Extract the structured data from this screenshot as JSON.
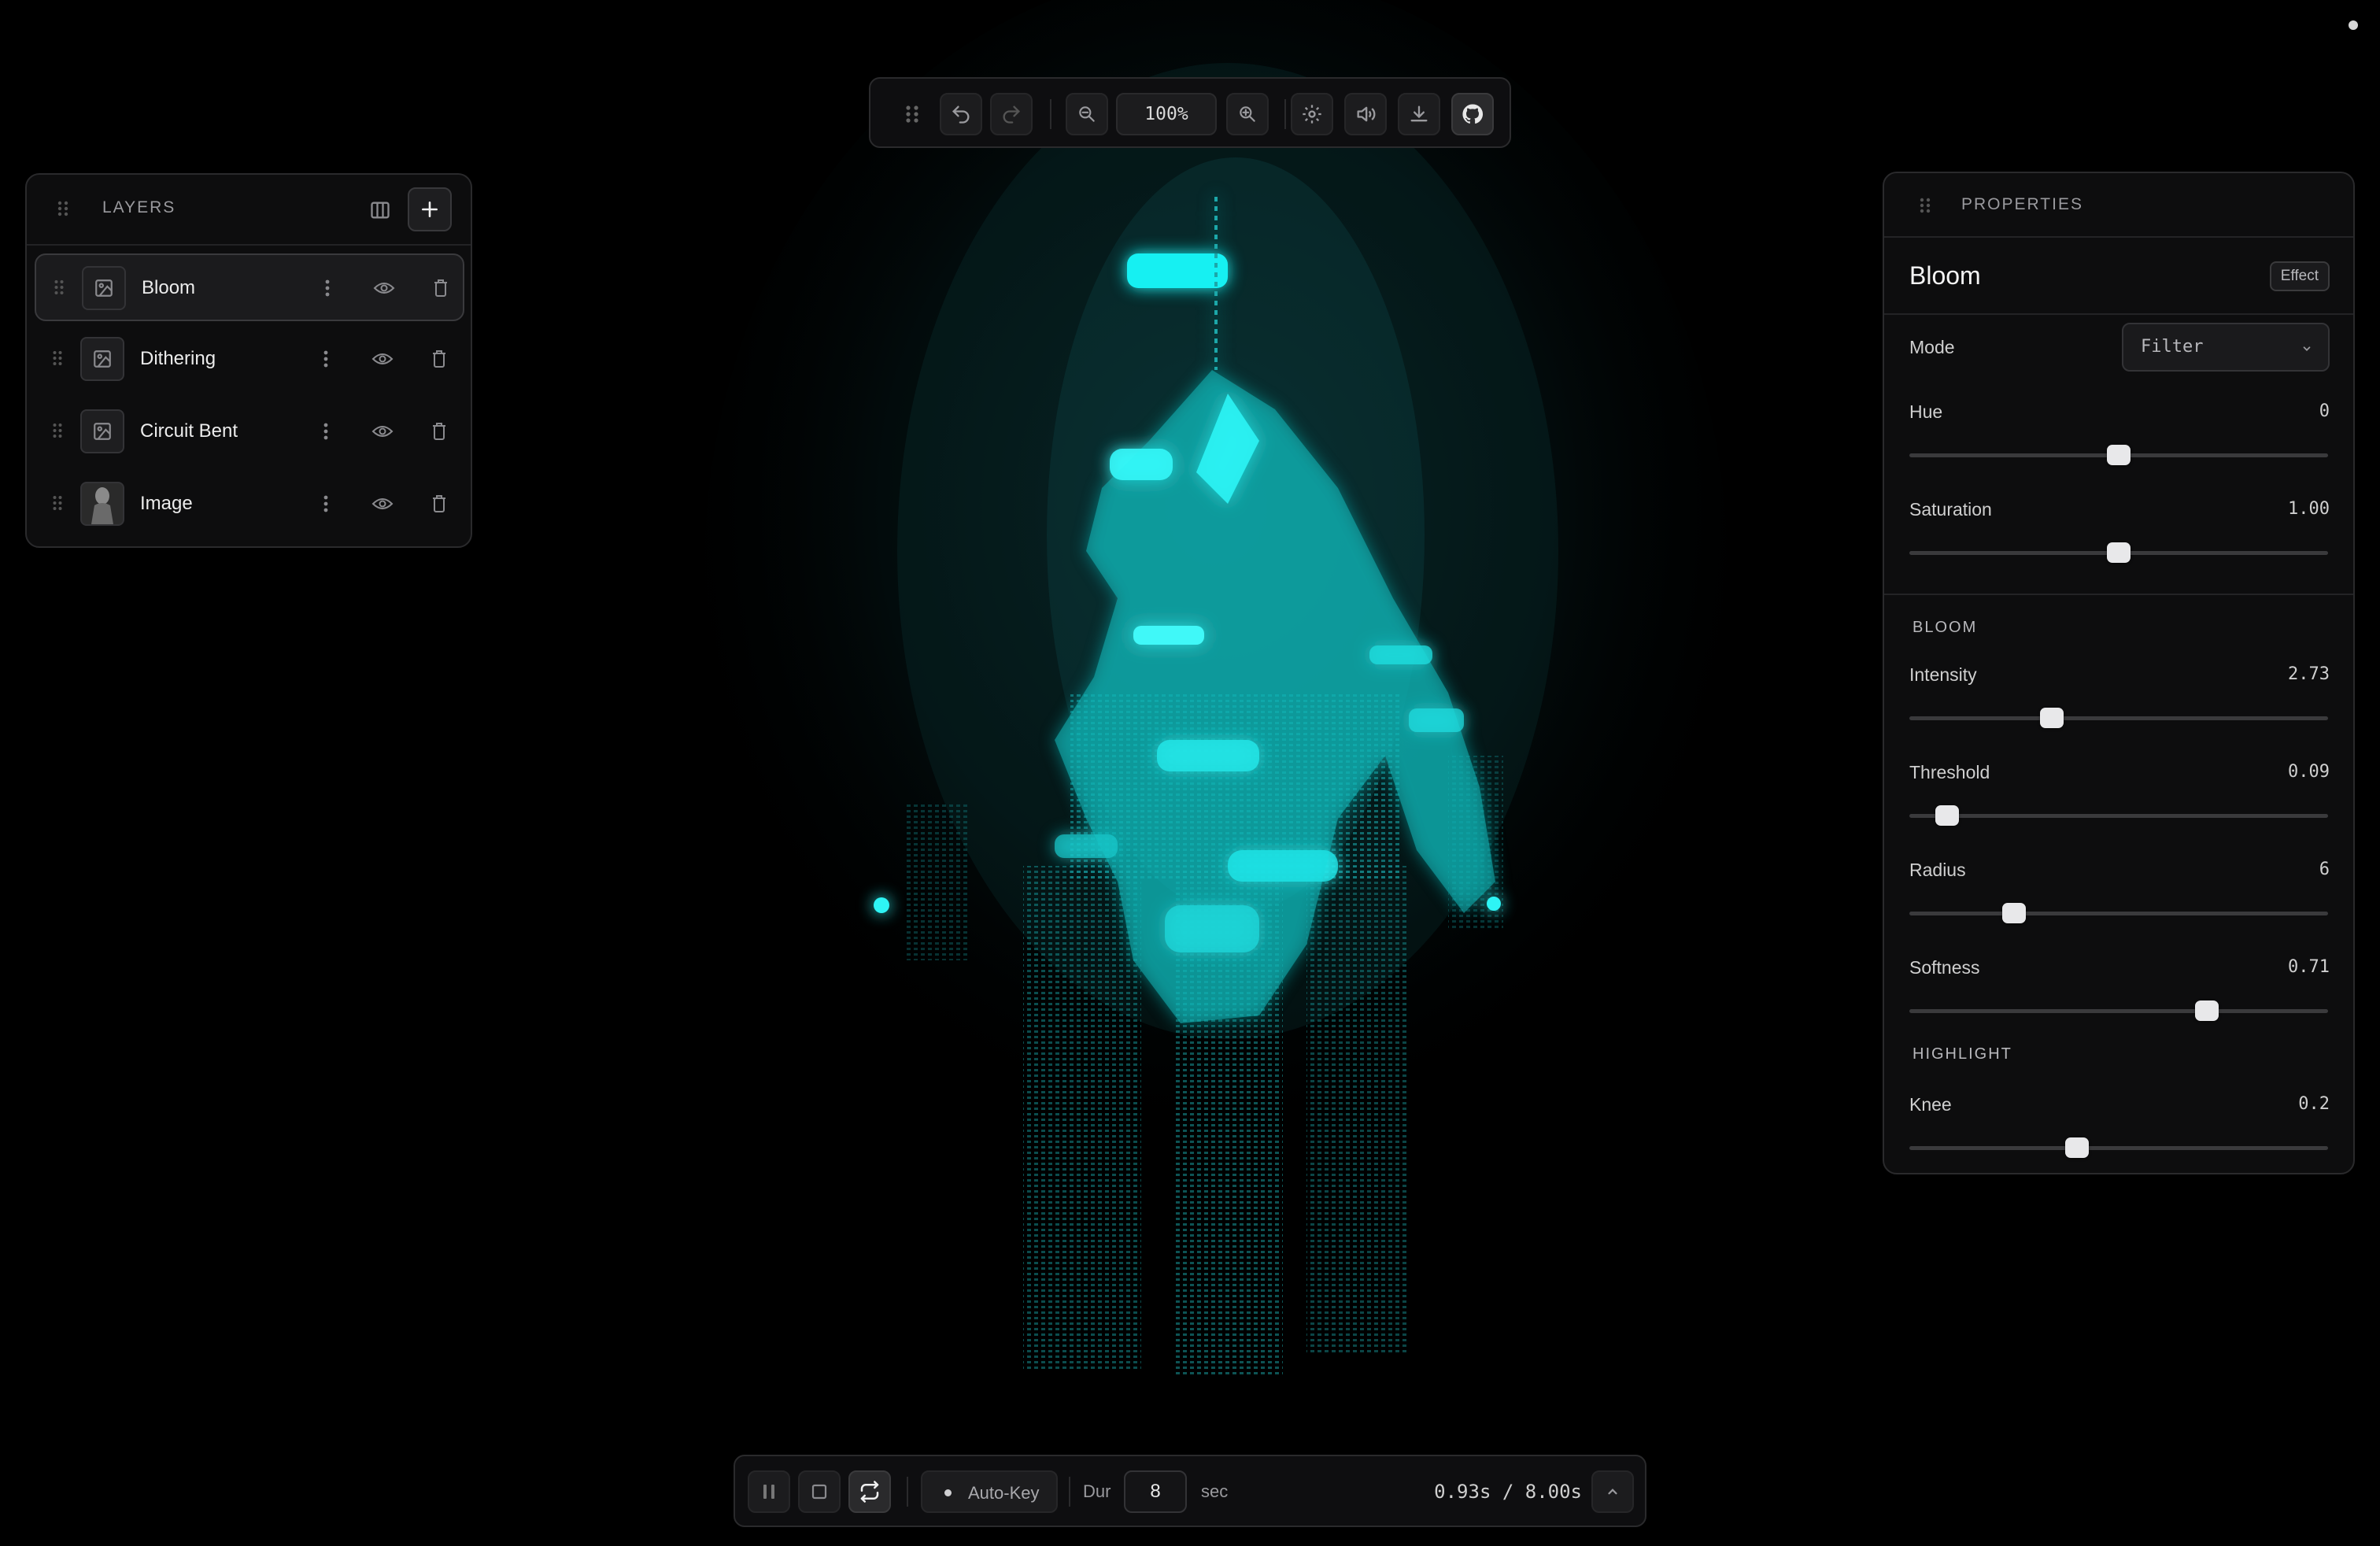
{
  "toolbar": {
    "zoom": "100%",
    "tools": [
      "drag-handle-icon",
      "undo-icon",
      "redo-icon",
      "zoom-out-icon",
      "zoom-in-icon",
      "settings-icon",
      "sound-icon",
      "download-icon",
      "github-icon"
    ]
  },
  "layers": {
    "title": "LAYERS",
    "items": [
      {
        "name": "Bloom",
        "selected": true
      },
      {
        "name": "Dithering",
        "selected": false
      },
      {
        "name": "Circuit Bent",
        "selected": false
      },
      {
        "name": "Image",
        "selected": false
      }
    ]
  },
  "properties": {
    "title": "PROPERTIES",
    "effect_name": "Bloom",
    "badge": "Effect",
    "mode_label": "Mode",
    "mode_value": "Filter",
    "hue": {
      "label": "Hue",
      "value": "0",
      "fraction": 0.5
    },
    "saturation": {
      "label": "Saturation",
      "value": "1.00",
      "fraction": 0.5
    },
    "bloom_section": "BLOOM",
    "intensity": {
      "label": "Intensity",
      "value": "2.73",
      "fraction": 0.34
    },
    "threshold": {
      "label": "Threshold",
      "value": "0.09",
      "fraction": 0.09
    },
    "radius": {
      "label": "Radius",
      "value": "6",
      "fraction": 0.25
    },
    "softness": {
      "label": "Softness",
      "value": "0.71",
      "fraction": 0.71
    },
    "highlight_section": "HIGHLIGHT",
    "knee": {
      "label": "Knee",
      "value": "0.2",
      "fraction": 0.4
    }
  },
  "transport": {
    "autokey_label": "Auto-Key",
    "dur_label": "Dur",
    "dur_value": "8",
    "sec_label": "sec",
    "time_display": "0.93s / 8.00s"
  },
  "colors": {
    "accent_glow": "#00e5e8",
    "panel_bg": "#0d0d0e"
  }
}
